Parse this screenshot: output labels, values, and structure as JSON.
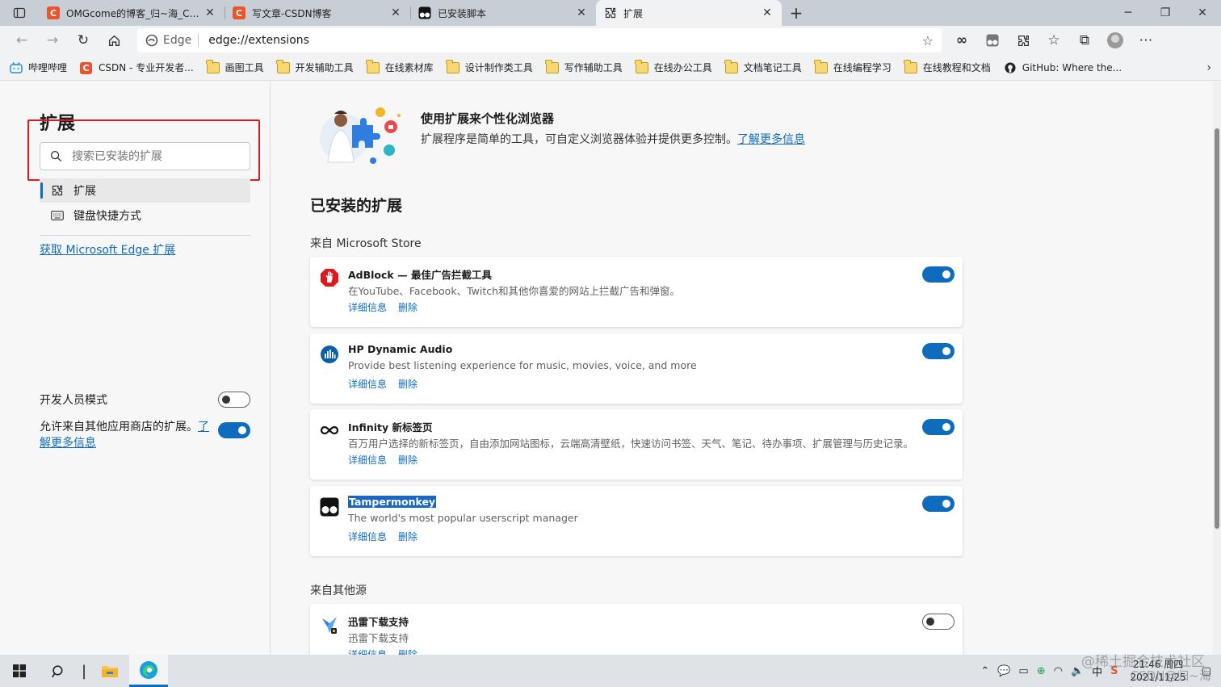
{
  "tabs": [
    {
      "title": "OMGcome的博客_归~海_CSDN博客",
      "favicon": "csdn-icon"
    },
    {
      "title": "写文章-CSDN博客",
      "favicon": "csdn-icon"
    },
    {
      "title": "已安装脚本",
      "favicon": "tampermonkey-icon"
    },
    {
      "title": "扩展",
      "favicon": "extensions-icon",
      "active": true
    }
  ],
  "toolbar": {
    "omnibox_label": "Edge",
    "url": "edge://extensions"
  },
  "favorites": [
    {
      "label": "哔哩哔哩",
      "icon": "bilibili-icon"
    },
    {
      "label": "CSDN - 专业开发者...",
      "icon": "csdn-icon"
    },
    {
      "label": "画图工具",
      "icon": "folder-icon"
    },
    {
      "label": "开发辅助工具",
      "icon": "folder-icon"
    },
    {
      "label": "在线素材库",
      "icon": "folder-icon"
    },
    {
      "label": "设计制作类工具",
      "icon": "folder-icon"
    },
    {
      "label": "写作辅助工具",
      "icon": "folder-icon"
    },
    {
      "label": "在线办公工具",
      "icon": "folder-icon"
    },
    {
      "label": "文档笔记工具",
      "icon": "folder-icon"
    },
    {
      "label": "在线编程学习",
      "icon": "folder-icon"
    },
    {
      "label": "在线教程和文档",
      "icon": "folder-icon"
    },
    {
      "label": "GitHub: Where the...",
      "icon": "github-icon"
    }
  ],
  "sidebar": {
    "title": "扩展",
    "search_placeholder": "搜索已安装的扩展",
    "nav": [
      {
        "label": "扩展",
        "icon": "extensions-icon"
      },
      {
        "label": "键盘快捷方式",
        "icon": "keyboard-icon"
      }
    ],
    "get_link": "获取 Microsoft Edge 扩展",
    "dev_mode_label": "开发人员模式",
    "allow_text": "允许来自其他应用商店的扩展。",
    "allow_link": "了解更多信息",
    "accent": "#0f6cbd",
    "highlight": "#e0191c"
  },
  "main": {
    "hero_title": "使用扩展来个性化浏览器",
    "hero_desc": "扩展程序是简单的工具，可自定义浏览器体验并提供更多控制。",
    "hero_link": "了解更多信息",
    "installed_title": "已安装的扩展",
    "store_group": "来自 Microsoft Store",
    "other_group": "来自其他源",
    "details_label": "详细信息",
    "remove_label": "删除",
    "extensions": [
      {
        "name": "AdBlock — 最佳广告拦截工具",
        "desc": "在YouTube、Facebook、Twitch和其他你喜爱的网站上拦截广告和弹窗。",
        "enabled": true,
        "icon": "adblock-icon"
      },
      {
        "name": "HP Dynamic Audio",
        "desc": "Provide best listening experience for music, movies, voice, and more",
        "enabled": true,
        "icon": "hp-audio-icon"
      },
      {
        "name": "Infinity 新标签页",
        "desc": "百万用户选择的新标签页，自由添加网站图标，云端高清壁纸，快速访问书签、天气、笔记、待办事项、扩展管理与历史记录。",
        "enabled": true,
        "icon": "infinity-icon"
      },
      {
        "name": "Tampermonkey",
        "desc": "The world's most popular userscript manager",
        "enabled": true,
        "icon": "tampermonkey-icon"
      }
    ],
    "other_extensions": [
      {
        "name": "迅雷下载支持",
        "desc": "迅雷下载支持",
        "enabled": false,
        "icon": "thunder-icon"
      }
    ]
  },
  "taskbar": {
    "time": "21:46 周四",
    "date": "2021/11/25",
    "ime": "中"
  },
  "watermark": {
    "line1": "@稀土掘金技术社区",
    "line2": "CSDN@归~海"
  }
}
